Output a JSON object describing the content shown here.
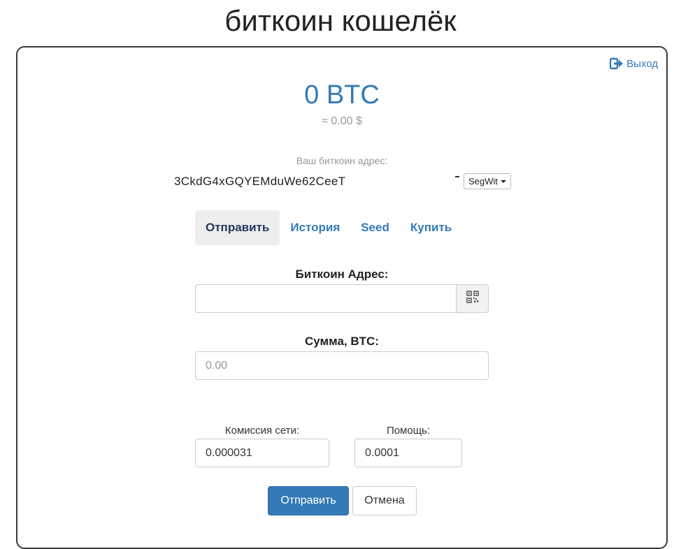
{
  "app": {
    "title": "биткоин кошелёк"
  },
  "header": {
    "logout_label": "Выход",
    "logout_icon": "logout-icon"
  },
  "balance": {
    "btc": "0 BTC",
    "usd": "≈ 0.00 $"
  },
  "address": {
    "label": "Ваш биткоин адрес:",
    "value": "3CkdG4xGQYEMduWe62CeeT",
    "type_label": "SegWit"
  },
  "tabs": [
    {
      "label": "Отправить",
      "active": true
    },
    {
      "label": "История",
      "active": false
    },
    {
      "label": "Seed",
      "active": false
    },
    {
      "label": "Купить",
      "active": false
    }
  ],
  "send_form": {
    "address_label": "Биткоин Адрес:",
    "address_value": "",
    "qr_icon": "qr-code-icon",
    "amount_label": "Сумма, BTC:",
    "amount_placeholder": "0.00",
    "fee_label": "Комиссия сети:",
    "fee_value": "0.000031",
    "help_label": "Помощь:",
    "help_value": "0.0001",
    "submit_label": "Отправить",
    "cancel_label": "Отмена"
  },
  "colors": {
    "accent": "#337ab7",
    "active_tab_bg": "#eeeeee",
    "border": "#3a3a3a"
  }
}
